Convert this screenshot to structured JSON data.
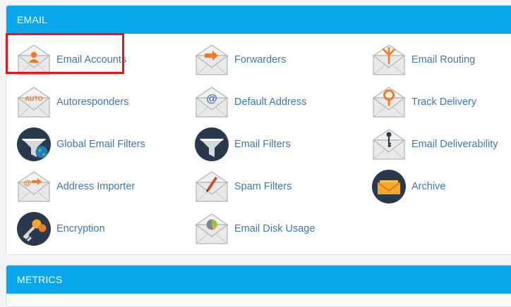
{
  "email_section": {
    "title": "EMAIL",
    "items": [
      {
        "label": "Email Accounts",
        "icon": "envelope-user-icon"
      },
      {
        "label": "Forwarders",
        "icon": "envelope-arrow-icon"
      },
      {
        "label": "Email Routing",
        "icon": "envelope-routing-icon"
      },
      {
        "label": "Autoresponders",
        "icon": "envelope-auto-icon"
      },
      {
        "label": "Default Address",
        "icon": "envelope-at-icon"
      },
      {
        "label": "Track Delivery",
        "icon": "envelope-map-pin-icon"
      },
      {
        "label": "Global Email Filters",
        "icon": "funnel-globe-icon"
      },
      {
        "label": "Email Filters",
        "icon": "funnel-icon"
      },
      {
        "label": "Email Deliverability",
        "icon": "envelope-key-icon"
      },
      {
        "label": "Address Importer",
        "icon": "envelope-import-icon"
      },
      {
        "label": "Spam Filters",
        "icon": "envelope-pen-icon"
      },
      {
        "label": "Archive",
        "icon": "archive-icon"
      },
      {
        "label": "Encryption",
        "icon": "encryption-keys-icon"
      },
      {
        "label": "Email Disk Usage",
        "icon": "envelope-pie-chart-icon"
      }
    ],
    "auto_badge": "AUTO"
  },
  "metrics_section": {
    "title": "METRICS"
  },
  "colors": {
    "header_blue": "#0aa7ec",
    "link_blue": "#3f77b4",
    "accent_orange": "#f47a20",
    "dark_navy": "#293a4f",
    "highlight_red": "#e8141b"
  }
}
